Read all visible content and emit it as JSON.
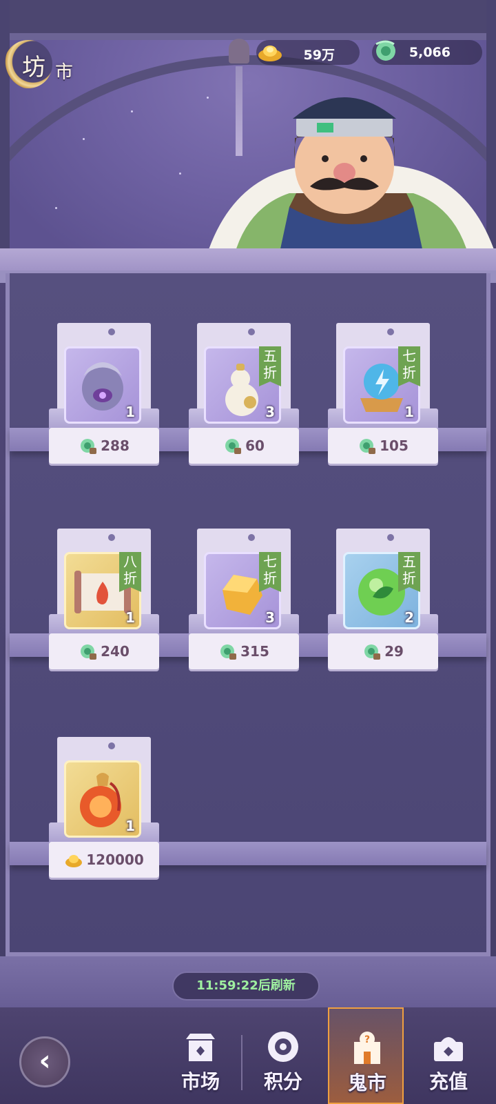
{
  "header": {
    "title_main": "坊",
    "title_sub": "市",
    "currency": [
      {
        "icon": "gold-ingot-icon",
        "value": "59万"
      },
      {
        "icon": "jade-dragon-icon",
        "value": "5,066"
      }
    ]
  },
  "shop": {
    "items": [
      {
        "name": "armor-egg-item-icon",
        "qty": "1",
        "discount": "",
        "price_icon": "jade-dragon-icon",
        "price": "288"
      },
      {
        "name": "gourd-item-icon",
        "qty": "3",
        "discount": "五折",
        "price_icon": "jade-dragon-icon",
        "price": "60"
      },
      {
        "name": "lightning-orb-item-icon",
        "qty": "1",
        "discount": "七折",
        "price_icon": "jade-dragon-icon",
        "price": "105"
      },
      {
        "name": "fire-scroll-item-icon",
        "qty": "1",
        "discount": "八折",
        "price_icon": "jade-dragon-icon",
        "price": "240"
      },
      {
        "name": "amber-crystal-item-icon",
        "qty": "3",
        "discount": "七折",
        "price_icon": "jade-dragon-icon",
        "price": "315"
      },
      {
        "name": "leaf-orb-item-icon",
        "qty": "2",
        "discount": "五折",
        "price_icon": "jade-dragon-icon",
        "price": "29"
      },
      {
        "name": "fire-pouch-item-icon",
        "qty": "1",
        "discount": "",
        "price_icon": "gold-ingot-icon",
        "price": "120000"
      }
    ],
    "refresh_text": "11:59:22后刷新"
  },
  "nav": {
    "tabs": [
      {
        "icon": "market-gate-icon",
        "label": "市场"
      },
      {
        "icon": "points-swirl-icon",
        "label": "积分"
      },
      {
        "icon": "ghost-market-icon",
        "label": "鬼市",
        "active": true
      },
      {
        "icon": "recharge-chest-icon",
        "label": "充值"
      }
    ],
    "back_icon": "back-arrow-icon"
  },
  "colors": {
    "accent": "#f0a040",
    "discount_green": "#6ea352",
    "refresh_text": "#9ff0a0"
  }
}
